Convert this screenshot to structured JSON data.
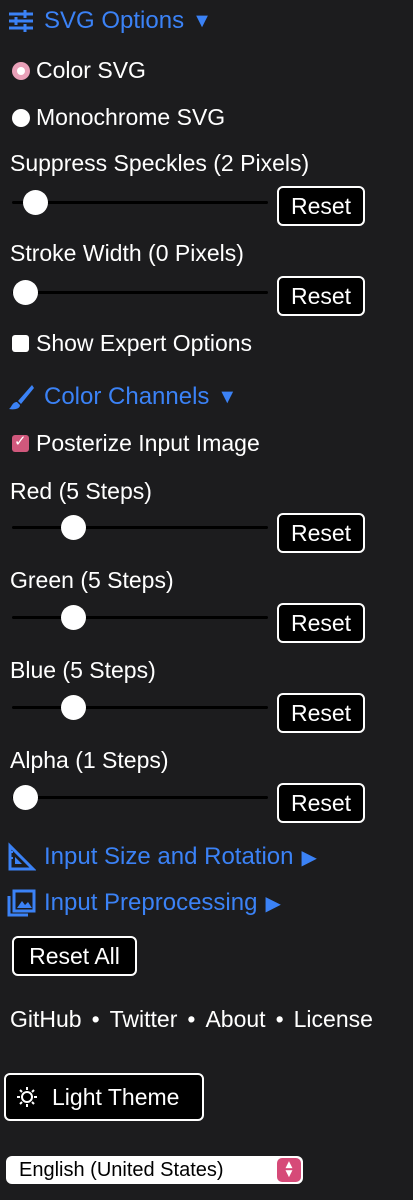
{
  "svg_options": {
    "title": "SVG Options",
    "arrow": "▼",
    "icon": "sliders-icon",
    "modes": [
      {
        "label": "Color SVG",
        "checked": true
      },
      {
        "label": "Monochrome SVG",
        "checked": false
      }
    ],
    "suppress": {
      "label": "Suppress Speckles (2 Pixels)",
      "value_fraction": 0.09,
      "reset": "Reset"
    },
    "stroke": {
      "label": "Stroke Width (0 Pixels)",
      "value_fraction": 0.05,
      "reset": "Reset"
    },
    "expert": {
      "label": "Show Expert Options",
      "checked": false
    }
  },
  "color_channels": {
    "title": "Color Channels",
    "arrow": "▼",
    "icon": "brush-icon",
    "posterize": {
      "label": "Posterize Input Image",
      "checked": true
    },
    "channels": [
      {
        "label": "Red (5 Steps)",
        "value_fraction": 0.24,
        "reset": "Reset"
      },
      {
        "label": "Green (5 Steps)",
        "value_fraction": 0.24,
        "reset": "Reset"
      },
      {
        "label": "Blue (5 Steps)",
        "value_fraction": 0.24,
        "reset": "Reset"
      },
      {
        "label": "Alpha (1 Steps)",
        "value_fraction": 0.05,
        "reset": "Reset"
      }
    ]
  },
  "input_size": {
    "title": "Input Size and Rotation",
    "arrow": "▶",
    "icon": "ruler-triangle-icon"
  },
  "input_preprocessing": {
    "title": "Input Preprocessing",
    "arrow": "▶",
    "icon": "image-icon"
  },
  "reset_all": "Reset All",
  "footer_links": [
    "GitHub",
    "Twitter",
    "About",
    "License"
  ],
  "separator": "•",
  "theme_button": {
    "label": "Light Theme",
    "icon": "sun-icon"
  },
  "language": {
    "selected": "English (United States)"
  },
  "colors": {
    "accent": "#3b82f6",
    "background": "#1c1c1e",
    "checkbox_checked": "#d0587c"
  }
}
